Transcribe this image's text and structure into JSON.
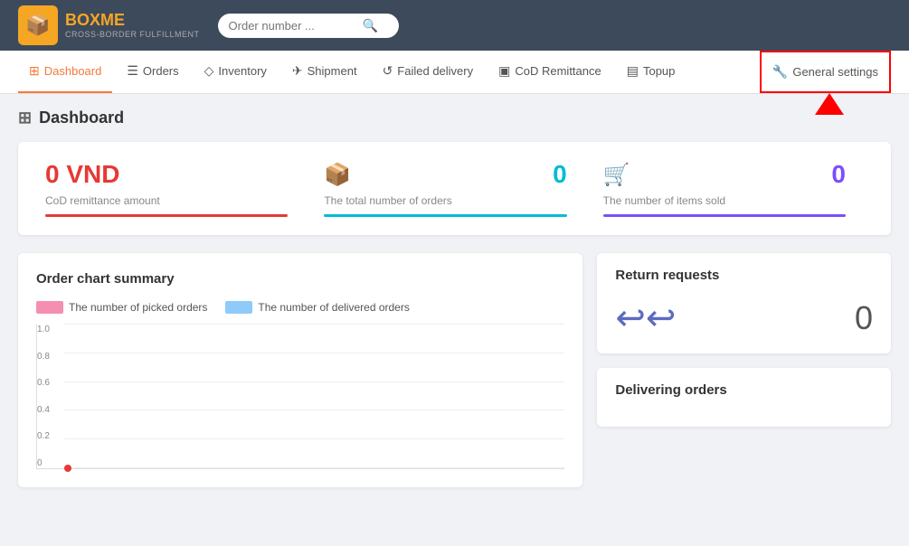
{
  "header": {
    "logo_text": "BOXME",
    "logo_sub": "CROSS-BORDER FULFILLMENT",
    "search_placeholder": "Order number ..."
  },
  "nav": {
    "items": [
      {
        "key": "dashboard",
        "label": "Dashboard",
        "icon": "⊞",
        "active": true
      },
      {
        "key": "orders",
        "label": "Orders",
        "icon": "☰"
      },
      {
        "key": "inventory",
        "label": "Inventory",
        "icon": "◇"
      },
      {
        "key": "shipment",
        "label": "Shipment",
        "icon": "✈"
      },
      {
        "key": "failed-delivery",
        "label": "Failed delivery",
        "icon": "↺"
      },
      {
        "key": "cod-remittance",
        "label": "CoD Remittance",
        "icon": "▣"
      },
      {
        "key": "topup",
        "label": "Topup",
        "icon": "▤"
      },
      {
        "key": "general-settings",
        "label": "General settings",
        "icon": "🔧"
      }
    ]
  },
  "page": {
    "title": "Dashboard",
    "title_icon": "⊞"
  },
  "stats": [
    {
      "key": "cod",
      "icon": "",
      "value": "0 VND",
      "label": "CoD remittance amount",
      "color": "red"
    },
    {
      "key": "orders",
      "icon": "📦",
      "value": "0",
      "label": "The total number of orders",
      "color": "teal"
    },
    {
      "key": "items",
      "icon": "🛒",
      "value": "0",
      "label": "The number of items sold",
      "color": "purple"
    }
  ],
  "chart": {
    "title": "Order chart summary",
    "legend": [
      {
        "key": "picked",
        "label": "The number of picked orders",
        "color": "pink"
      },
      {
        "key": "delivered",
        "label": "The number of delivered orders",
        "color": "blue"
      }
    ],
    "y_labels": [
      "0",
      "0.2",
      "0.4",
      "0.6",
      "0.8",
      "1.0"
    ]
  },
  "return_requests": {
    "title": "Return requests",
    "value": "0"
  },
  "delivering_orders": {
    "title": "Delivering orders"
  }
}
